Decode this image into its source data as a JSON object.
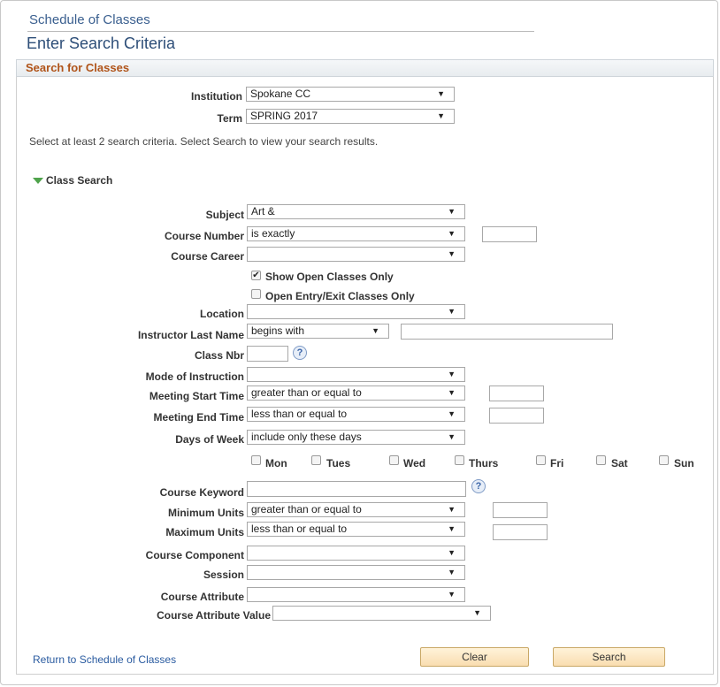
{
  "page": {
    "breadcrumb_title": "Schedule of Classes",
    "title": "Enter Search Criteria",
    "panel_title": "Search for Classes"
  },
  "institution": {
    "label": "Institution",
    "value": "Spokane CC"
  },
  "term": {
    "label": "Term",
    "value": "SPRING 2017"
  },
  "note": "Select at least 2 search criteria. Select Search to view your search results.",
  "class_search": {
    "header": "Class Search",
    "subject": {
      "label": "Subject",
      "value": "Art &"
    },
    "course_number": {
      "label": "Course Number",
      "operator": "is exactly",
      "value": ""
    },
    "course_career": {
      "label": "Course Career",
      "value": ""
    },
    "show_open": {
      "label": "Show Open Classes Only",
      "checked_mark": "✔"
    },
    "open_entry": {
      "label": "Open Entry/Exit Classes Only"
    },
    "location": {
      "label": "Location",
      "value": ""
    },
    "instructor": {
      "label": "Instructor Last Name",
      "operator": "begins with",
      "value": ""
    },
    "class_nbr": {
      "label": "Class Nbr",
      "value": ""
    },
    "mode": {
      "label": "Mode of Instruction",
      "value": ""
    },
    "meeting_start": {
      "label": "Meeting Start Time",
      "operator": "greater than or equal to",
      "value": ""
    },
    "meeting_end": {
      "label": "Meeting End Time",
      "operator": "less than or equal to",
      "value": ""
    },
    "days": {
      "label": "Days of Week",
      "operator": "include only these days"
    },
    "day_names": [
      "Mon",
      "Tues",
      "Wed",
      "Thurs",
      "Fri",
      "Sat",
      "Sun"
    ],
    "keyword": {
      "label": "Course Keyword",
      "value": ""
    },
    "min_units": {
      "label": "Minimum Units",
      "operator": "greater than or equal to",
      "value": ""
    },
    "max_units": {
      "label": "Maximum Units",
      "operator": "less than or equal to",
      "value": ""
    },
    "component": {
      "label": "Course Component",
      "value": ""
    },
    "session": {
      "label": "Session",
      "value": ""
    },
    "attribute": {
      "label": "Course Attribute",
      "value": ""
    },
    "attribute_value": {
      "label": "Course Attribute Value",
      "value": ""
    }
  },
  "footer": {
    "return_link": "Return to Schedule of Classes",
    "clear_label": "Clear",
    "search_label": "Search"
  },
  "icons": {
    "dropdown": "▼",
    "help": "?"
  },
  "colors": {
    "accent_header": "#b0541a",
    "link": "#2a5ba0",
    "button_fill": "#f9ddb0"
  }
}
